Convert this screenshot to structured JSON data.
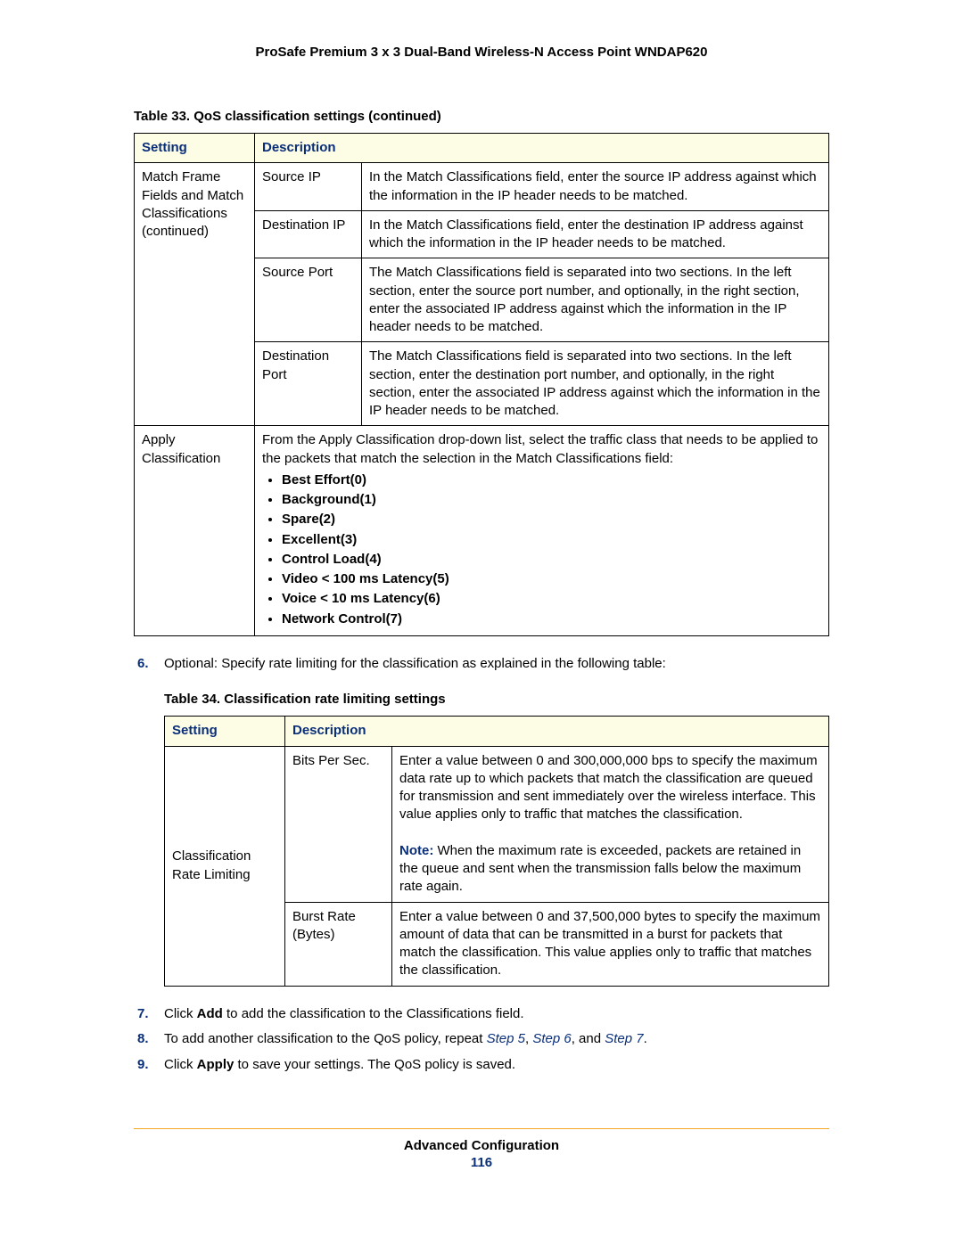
{
  "header": {
    "title": "ProSafe Premium 3 x 3 Dual-Band Wireless-N Access Point WNDAP620"
  },
  "table33": {
    "caption": "Table 33.  QoS classification settings (continued)",
    "head": {
      "setting": "Setting",
      "description": "Description"
    },
    "group1_label": "Match Frame Fields and Match Classifications (continued)",
    "rows": [
      {
        "sub": "Source IP",
        "desc": "In the Match Classifications field, enter the source IP address against which the information in the IP header needs to be matched."
      },
      {
        "sub": "Destination IP",
        "desc": "In the Match Classifications field, enter the destination IP address against which the information in the IP header needs to be matched."
      },
      {
        "sub": "Source Port",
        "desc": "The Match Classifications field is separated into two sections. In the left section, enter the source port number, and optionally, in the right section, enter the associated IP address against which the information in the IP header needs to be matched."
      },
      {
        "sub": "Destination Port",
        "desc": "The Match Classifications field is separated into two sections. In the left section, enter the destination port number, and optionally, in the right section, enter the associated IP address against which the information in the IP header needs to be matched."
      }
    ],
    "apply": {
      "label": "Apply Classification",
      "intro": "From the Apply Classification drop-down list, select the traffic class that needs to be applied to the packets that match the selection in the Match Classifications field:",
      "items": [
        "Best Effort(0)",
        "Background(1)",
        "Spare(2)",
        "Excellent(3)",
        "Control Load(4)",
        "Video < 100 ms Latency(5)",
        "Voice < 10 ms Latency(6)",
        "Network Control(7)"
      ]
    }
  },
  "step6": {
    "text": "Optional: Specify rate limiting for the classification as explained in the following table:"
  },
  "table34": {
    "caption": "Table 34.  Classification rate limiting settings",
    "head": {
      "setting": "Setting",
      "description": "Description"
    },
    "group_label": "Classification Rate Limiting",
    "rows": [
      {
        "sub": "Bits Per Sec.",
        "desc": "Enter a value between 0 and 300,000,000 bps to specify the maximum data rate up to which packets that match the classification are queued for transmission and sent immediately over the wireless interface. This value applies only to traffic that matches the classification.",
        "note_label": "Note:",
        "note": "When the maximum rate is exceeded, packets are retained in the queue and sent when the transmission falls below the maximum rate again."
      },
      {
        "sub": "Burst Rate (Bytes)",
        "desc": "Enter a value between 0 and 37,500,000 bytes to specify the maximum amount of data that can be transmitted in a burst for packets that match the classification. This value applies only to traffic that matches the classification."
      }
    ]
  },
  "steps_after": {
    "s7_a": "Click ",
    "s7_add": "Add",
    "s7_b": " to add the classification to the Classifications field.",
    "s8_a": "To add another classification to the QoS policy, repeat ",
    "s8_l1": "Step 5",
    "s8_c1": ", ",
    "s8_l2": "Step 6",
    "s8_c2": ", and ",
    "s8_l3": "Step 7",
    "s8_end": ".",
    "s9_a": "Click ",
    "s9_apply": "Apply",
    "s9_b": " to save your settings. The QoS policy is saved."
  },
  "footer": {
    "section": "Advanced Configuration",
    "page": "116"
  }
}
